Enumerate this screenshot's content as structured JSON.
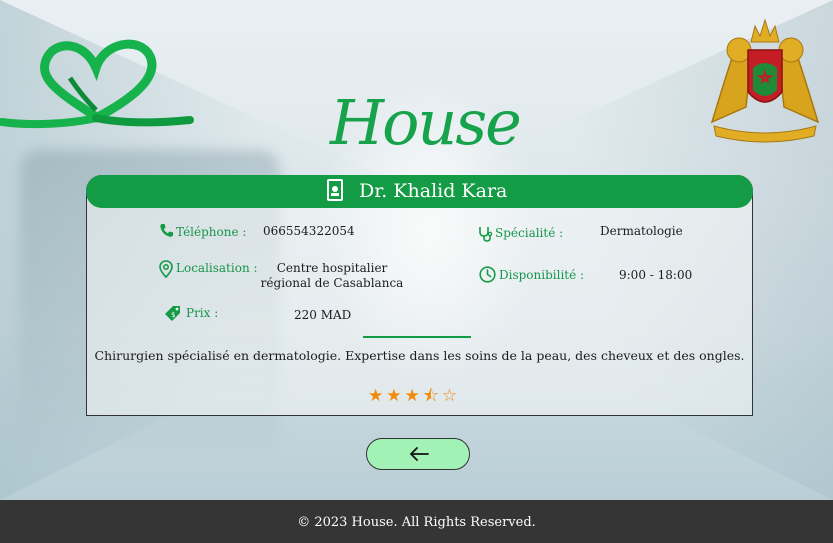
{
  "brand": {
    "title": "House"
  },
  "doctor": {
    "name": "Dr. Khalid Kara"
  },
  "fields": {
    "telephone": {
      "label": "Téléphone :",
      "value": "066554322054"
    },
    "localisation": {
      "label": "Localisation :",
      "value_line1": "Centre hospitalier",
      "value_line2": "régional de Casablanca"
    },
    "prix": {
      "label": "Prix :",
      "value": "220 MAD"
    },
    "specialite": {
      "label": "Spécialité :",
      "value": "Dermatologie"
    },
    "disponibilite": {
      "label": "Disponibilité :",
      "value": "9:00 - 18:00"
    }
  },
  "description": "Chirurgien spécialisé en dermatologie. Expertise dans les soins de la peau, des cheveux et des ongles.",
  "rating": {
    "value": 3.5,
    "max": 5,
    "stars": "★★★⯪☆"
  },
  "footer": {
    "copyright": "© 2023 House. All Rights Reserved."
  },
  "colors": {
    "brand_green": "#149b45",
    "label_green": "#15964a",
    "star_orange": "#f28a0c",
    "button_bg": "#a3f2b5",
    "footer_bg": "#353535"
  },
  "icons": [
    "heart-ribbon-icon",
    "coat-of-arms-emblem",
    "doctor-badge-icon",
    "phone-icon",
    "location-pin-icon",
    "price-tag-icon",
    "stethoscope-icon",
    "clock-icon",
    "arrow-left-icon"
  ]
}
